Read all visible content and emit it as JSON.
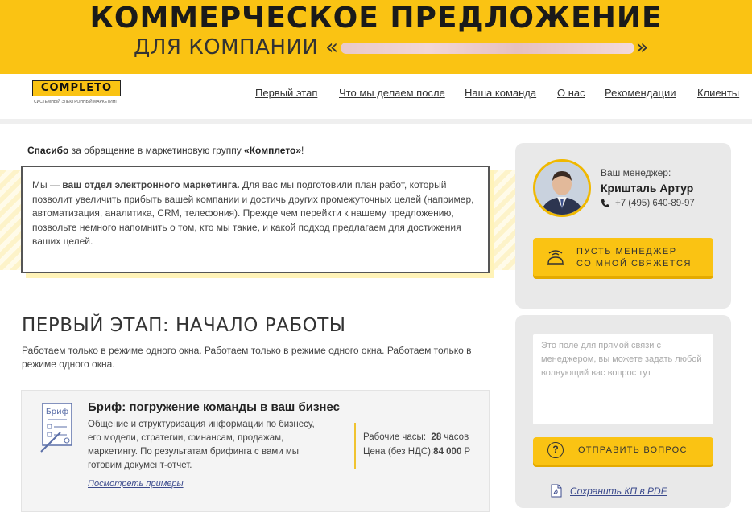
{
  "banner": {
    "title": "КОММЕРЧЕСКОЕ ПРЕДЛОЖЕНИЕ",
    "subtitle_prefix": "ДЛЯ КОМПАНИИ «",
    "subtitle_suffix": "»"
  },
  "logo": {
    "name": "COMPLETO",
    "tagline": "СИСТЕМНЫЙ ЭЛЕКТРОННЫЙ МАРКЕТИНГ"
  },
  "nav": {
    "items": [
      {
        "label": "Первый этап"
      },
      {
        "label": "Что мы делаем после"
      },
      {
        "label": "Наша команда"
      },
      {
        "label": "О нас"
      },
      {
        "label": "Рекомендации"
      },
      {
        "label": "Клиенты"
      }
    ]
  },
  "thanks": {
    "bold1": "Спасибо",
    "text": " за обращение в маркетиновую группу ",
    "bold2": "«Комплето»",
    "end": "!"
  },
  "intro": {
    "start": "Мы — ",
    "bold": "ваш отдел электронного маркетинга.",
    "rest": " Для вас мы подготовили план работ, который позволит увеличить прибыть вашей компании и достичь других промежуточных целей (например, автоматизация, аналитика, CRM, телефония). Прежде чем перейкти к нашему предложению, позвольте немного напомнить о том, кто мы такие, и какой подход предлагаем для достижения ваших целей."
  },
  "section": {
    "title": "ПЕРВЫЙ ЭТАП: НАЧАЛО РАБОТЫ",
    "lead": "Работаем только в режиме одного окна. Работаем только в режиме одного окна. Работаем только в режиме одного окна."
  },
  "brief": {
    "icon_label": "Бриф",
    "title": "Бриф: погружение команды в ваш бизнес",
    "text": "Общение и структуризация информации по бизнесу, его модели, стратегии, финансам, продажам, маркетингу. По результатам брифинга с вами мы готовим документ-отчет.",
    "hours_label": "Рабочие часы:",
    "hours_value": "28",
    "hours_unit": " часов",
    "price_label": "Цена (без НДС):",
    "price_value": "84 000",
    "price_unit": " Р",
    "examples_link": "Посмотреть примеры"
  },
  "manager": {
    "label": "Ваш менеджер:",
    "name": "Кришталь Артур",
    "phone": "+7 (495) 640-89-97",
    "callback_line1": "ПУСТЬ МЕНЕДЖЕР",
    "callback_line2": "СО МНОЙ СВЯЖЕТСЯ"
  },
  "question": {
    "placeholder": "Это поле для прямой связи с менеджером, вы можете задать любой волнующий вас вопрос тут",
    "send_label": "ОТПРАВИТЬ ВОПРОС",
    "send_icon": "?",
    "pdf_link": "Сохранить КП в PDF"
  },
  "colors": {
    "accent": "#fac313",
    "link": "#3b4a8c",
    "panel": "#e9e9e9"
  }
}
